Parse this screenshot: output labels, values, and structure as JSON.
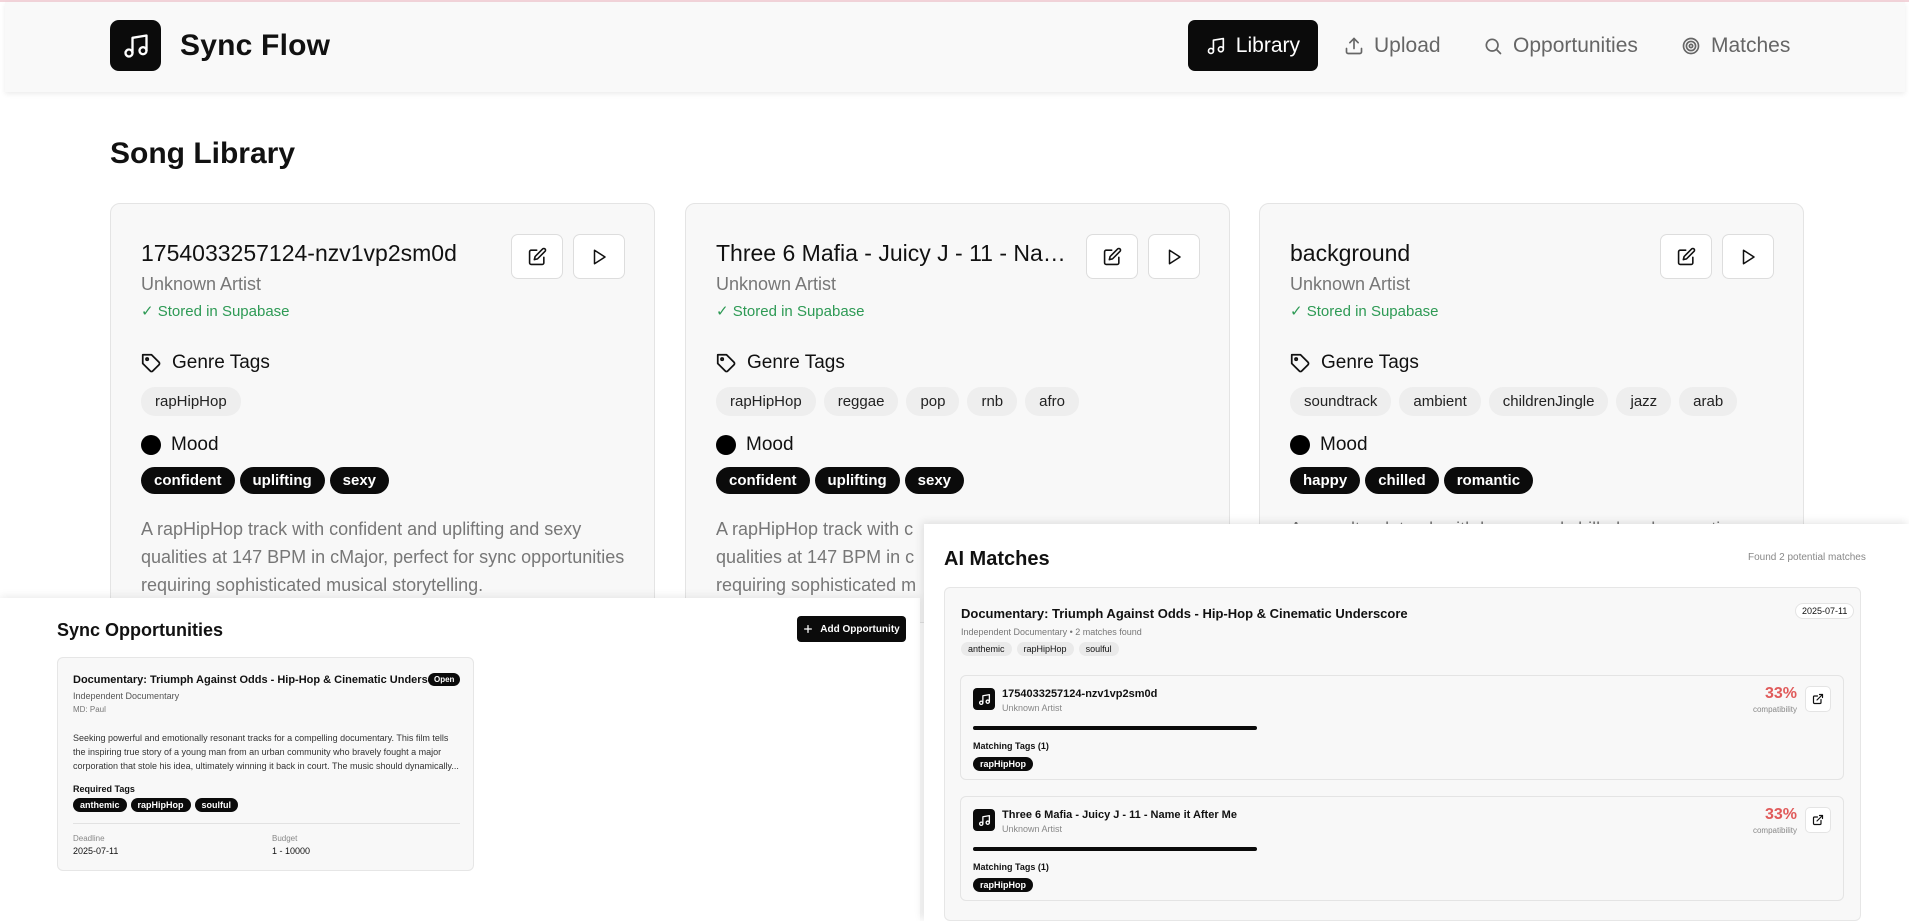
{
  "app": {
    "title": "Sync Flow"
  },
  "nav": [
    {
      "label": "Library",
      "icon": "music-note-icon",
      "active": true
    },
    {
      "label": "Upload",
      "icon": "upload-icon",
      "active": false
    },
    {
      "label": "Opportunities",
      "icon": "search-icon",
      "active": false
    },
    {
      "label": "Matches",
      "icon": "target-icon",
      "active": false
    }
  ],
  "library": {
    "heading": "Song Library",
    "genre_heading": "Genre Tags",
    "mood_heading": "Mood",
    "songs": [
      {
        "title": "1754033257124-nzv1vp2sm0d",
        "artist": "Unknown Artist",
        "stored": "✓ Stored in Supabase",
        "genres": [
          "rapHipHop"
        ],
        "moods": [
          "confident",
          "uplifting",
          "sexy"
        ],
        "description": "A rapHipHop track with confident and uplifting and sexy qualities at 147 BPM in cMajor, perfect for sync opportunities requiring sophisticated musical storytelling."
      },
      {
        "title": "Three 6 Mafia - Juicy J - 11 - Name it After Me",
        "artist": "Unknown Artist",
        "stored": "✓ Stored in Supabase",
        "genres": [
          "rapHipHop",
          "reggae",
          "pop",
          "rnb",
          "afro"
        ],
        "moods": [
          "confident",
          "uplifting",
          "sexy"
        ],
        "description": "A rapHipHop track with c qualities at 147 BPM in c requiring sophisticated m"
      },
      {
        "title": "background",
        "artist": "Unknown Artist",
        "stored": "✓ Stored in Supabase",
        "genres": [
          "soundtrack",
          "ambient",
          "childrenJingle",
          "jazz",
          "arab"
        ],
        "moods": [
          "happy",
          "chilled",
          "romantic"
        ],
        "description": "A soundtrack track with happy and chilled and romantic"
      }
    ]
  },
  "opportunities": {
    "heading": "Sync Opportunities",
    "add_label": "Add Opportunity",
    "card": {
      "title": "Documentary: Triumph Against Odds - Hip-Hop & Cinematic Underscore",
      "status": "Open",
      "company": "Independent Documentary",
      "md": "MD: Paul",
      "description": "Seeking powerful and emotionally resonant tracks for a compelling documentary. This film tells the inspiring true story of a young man from an urban community who bravely fought a major corporation that stole his idea, ultimately winning it back in court. The music should dynamically...",
      "required_label": "Required Tags",
      "tags": [
        "anthemic",
        "rapHipHop",
        "soulful"
      ],
      "deadline_label": "Deadline",
      "deadline": "2025-07-11",
      "budget_label": "Budget",
      "budget": "1 - 10000"
    }
  },
  "matches": {
    "heading": "AI Matches",
    "found": "Found 2 potential matches",
    "opportunity": {
      "title": "Documentary: Triumph Against Odds - Hip-Hop & Cinematic Underscore",
      "date": "2025-07-11",
      "subtitle": "Independent Documentary • 2 matches found",
      "tags": [
        "anthemic",
        "rapHipHop",
        "soulful"
      ]
    },
    "items": [
      {
        "title": "1754033257124-nzv1vp2sm0d",
        "artist": "Unknown Artist",
        "percent": "33%",
        "compat": "compatibility",
        "score": 0.33,
        "tags_label": "Matching Tags (1)",
        "tags": [
          "rapHipHop"
        ]
      },
      {
        "title": "Three 6 Mafia - Juicy J - 11 - Name it After Me",
        "artist": "Unknown Artist",
        "percent": "33%",
        "compat": "compatibility",
        "score": 0.33,
        "tags_label": "Matching Tags (1)",
        "tags": [
          "rapHipHop"
        ]
      }
    ]
  }
}
